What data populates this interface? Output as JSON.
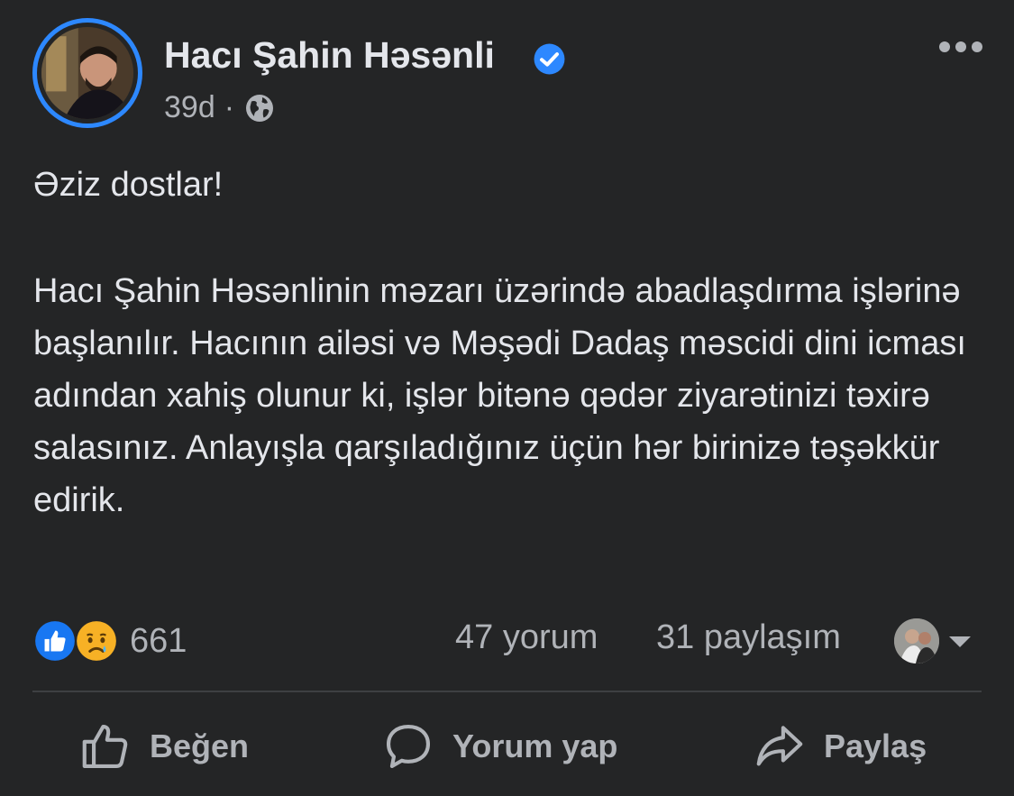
{
  "post": {
    "author": "Hacı Şahin Həsənli",
    "time": "39d",
    "separator": "·",
    "greeting": "Əziz dostlar!",
    "body": "Hacı Şahin Həsənlinin məzarı üzərində abadlaşdırma işlərinə başlanılır. Hacının ailəsi və Məşədi Dadaş məscidi dini icması adından xahiş olunur ki, işlər bitənə qədər ziyarətinizi təxirə salasınız. Anlayışla qarşıladığınız üçün hər birinizə təşəkkür edirik."
  },
  "stats": {
    "reactions_count": "661",
    "comments": "47 yorum",
    "shares": "31 paylaşım"
  },
  "actions": {
    "like": "Beğen",
    "comment": "Yorum yap",
    "share": "Paylaş"
  },
  "icons": {
    "verified": "verified-badge-icon",
    "audience": "globe-icon",
    "more": "more-horizontal-icon",
    "reaction_1": "like-reaction-icon",
    "reaction_2": "sad-reaction-icon",
    "like": "thumbs-up-outline-icon",
    "comment": "speech-bubble-icon",
    "share": "share-arrow-icon"
  },
  "colors": {
    "background": "#242526",
    "primary_text": "#e4e6eb",
    "secondary_text": "#b0b3b8",
    "accent": "#2d88ff",
    "divider": "#3e4042"
  }
}
